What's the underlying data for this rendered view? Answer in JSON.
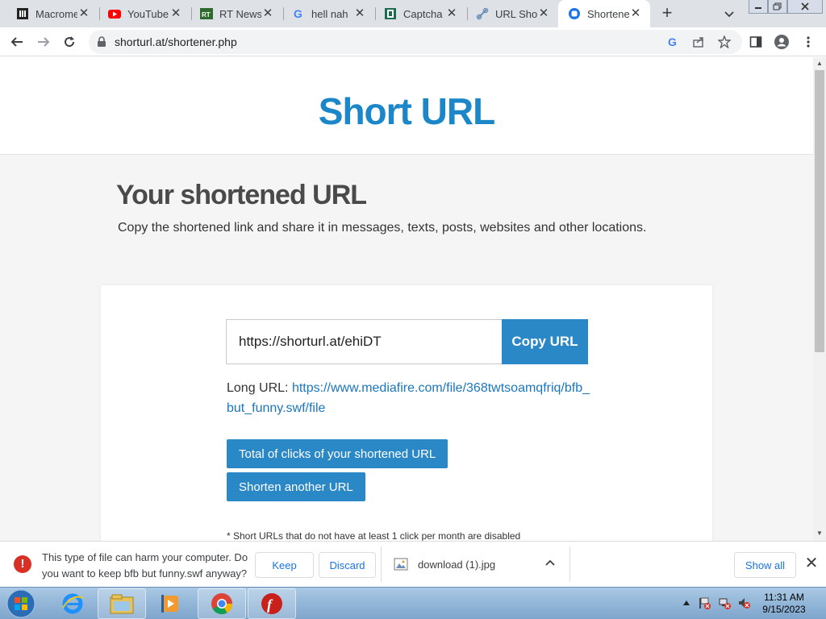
{
  "browser": {
    "tabs": [
      {
        "title": "Macrome",
        "icon": "macromedia-icon"
      },
      {
        "title": "YouTube",
        "icon": "youtube-icon"
      },
      {
        "title": "RT News",
        "icon": "rt-news-icon"
      },
      {
        "title": "hell nah",
        "icon": "google-icon"
      },
      {
        "title": "Captcha",
        "icon": "captcha-icon"
      },
      {
        "title": "URL Shor",
        "icon": "url-shortener-icon"
      },
      {
        "title": "Shortene",
        "icon": "shortener-icon",
        "active": true
      }
    ],
    "url": "shorturl.at/shortener.php"
  },
  "page": {
    "site_title": "Short URL",
    "heading": "Your shortened URL",
    "subtext": "Copy the shortened link and share it in messages, texts, posts, websites and other locations.",
    "short_url": "https://shorturl.at/ehiDT",
    "copy_button": "Copy URL",
    "long_url_label": "Long URL:",
    "long_url": "https://www.mediafire.com/file/368twtsoamqfriq/bfb_but_funny.swf/file",
    "clicks_button": "Total of clicks of your shortened URL",
    "shorten_another_button": "Shorten another URL",
    "note": "* Short URLs that do not have at least 1 click per month are disabled"
  },
  "download_bar": {
    "warning": "This type of file can harm your computer. Do you want to keep bfb but funny.swf anyway?",
    "keep": "Keep",
    "discard": "Discard",
    "file_name": "download (1).jpg",
    "show_all": "Show all"
  },
  "taskbar": {
    "time": "11:31 AM",
    "date": "9/15/2023",
    "apps": [
      "internet-explorer-icon",
      "file-explorer-icon",
      "media-player-icon",
      "chrome-icon",
      "flash-player-icon"
    ]
  },
  "colors": {
    "accent": "#1b86c8",
    "button": "#2b88c7",
    "link": "#1b76bc",
    "warning": "#d93025"
  }
}
